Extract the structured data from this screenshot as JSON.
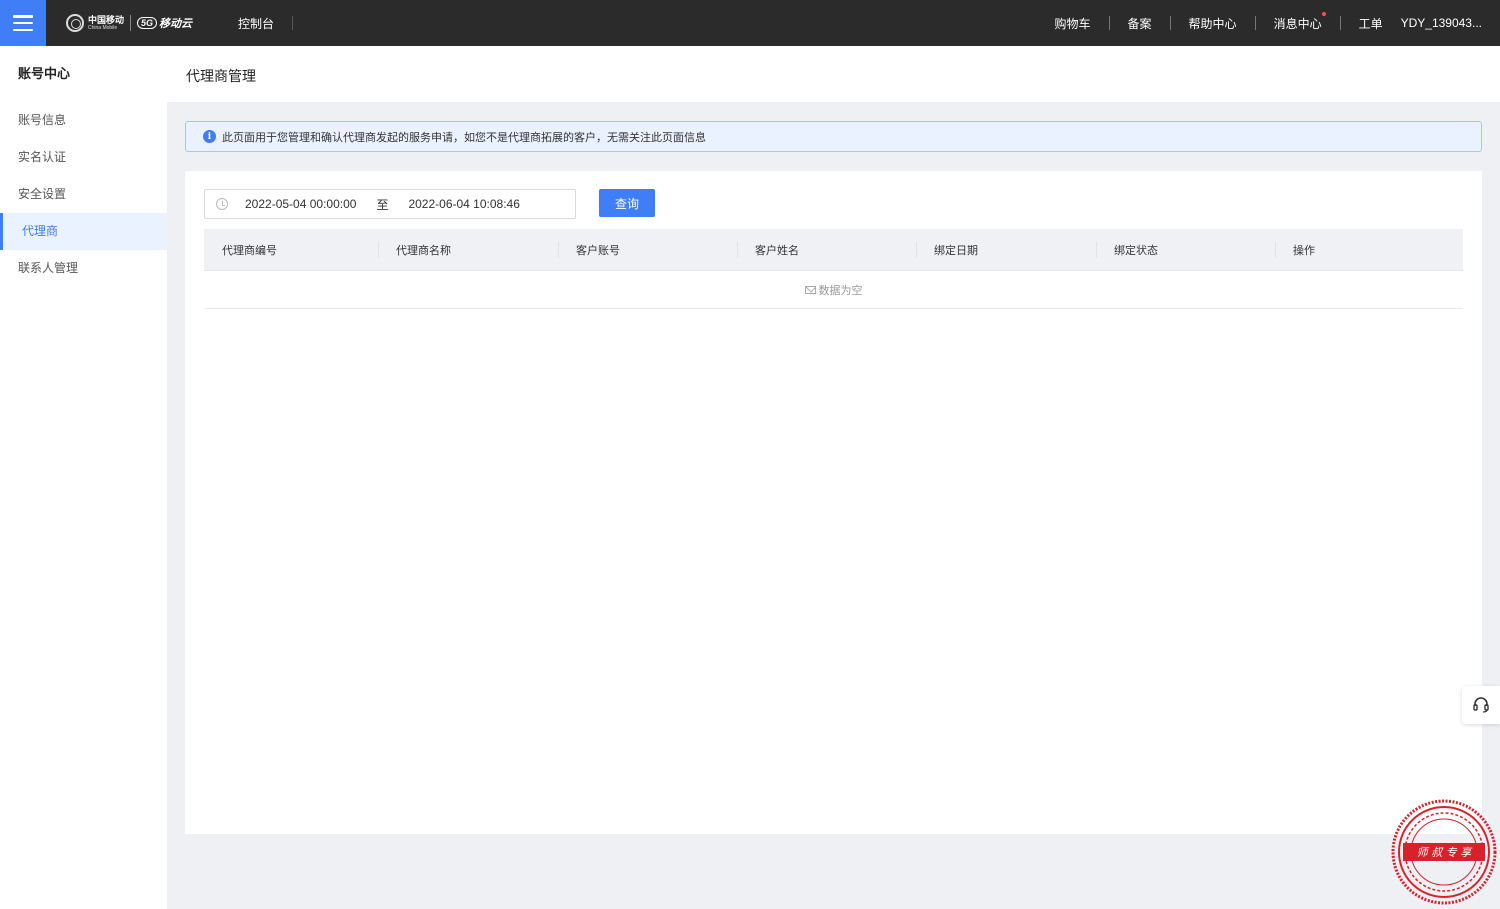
{
  "topbar": {
    "logo_cn": "中国移动",
    "logo_en": "China Mobile",
    "cloud_badge": "5G",
    "cloud_name": "移动云",
    "console": "控制台",
    "nav": [
      {
        "label": "购物车"
      },
      {
        "label": "备案"
      },
      {
        "label": "帮助中心"
      },
      {
        "label": "消息中心"
      },
      {
        "label": "工单"
      }
    ],
    "user": "YDY_139043..."
  },
  "sidebar": {
    "title": "账号中心",
    "items": [
      {
        "label": "账号信息"
      },
      {
        "label": "实名认证"
      },
      {
        "label": "安全设置"
      },
      {
        "label": "代理商"
      },
      {
        "label": "联系人管理"
      }
    ]
  },
  "page": {
    "title": "代理商管理",
    "notice": "此页面用于您管理和确认代理商发起的服务申请，如您不是代理商拓展的客户，无需关注此页面信息"
  },
  "filter": {
    "start": "2022-05-04 00:00:00",
    "separator": "至",
    "end": "2022-06-04 10:08:46",
    "query_label": "查询"
  },
  "table": {
    "columns": [
      "代理商编号",
      "代理商名称",
      "客户账号",
      "客户姓名",
      "绑定日期",
      "绑定状态",
      "操作"
    ],
    "empty_text": "数据为空"
  },
  "seal_text": "师 叔 专 享",
  "colors": {
    "accent": "#3f7ef7",
    "topbar_bg": "#2b2b2b",
    "notice_bg": "#eaf1ff",
    "seal_red": "#d9212b"
  }
}
